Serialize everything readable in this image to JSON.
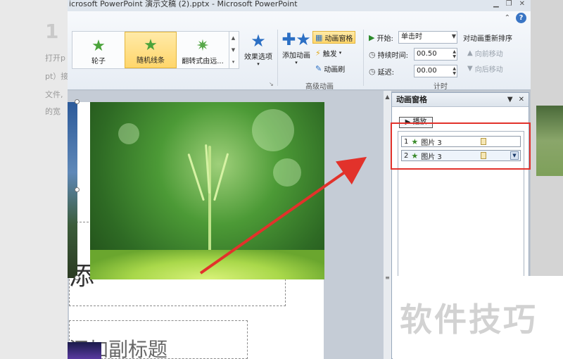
{
  "window": {
    "title": "icrosoft PowerPoint 演示文稿 (2).pptx - Microsoft PowerPoint"
  },
  "background": {
    "big_number": "1",
    "lines": [
      "打开p",
      "pt）接",
      "文件,",
      "的宽"
    ]
  },
  "ribbon": {
    "gallery_items": [
      {
        "label": "轮子",
        "icon": "star-icon"
      },
      {
        "label": "随机线条",
        "icon": "star-icon",
        "selected": true
      },
      {
        "label": "翻转式由远...",
        "icon": "star-burst-icon"
      }
    ],
    "effect_options": {
      "label": "效果选项",
      "icon": "star-icon"
    },
    "add_animation": {
      "label": "添加动画",
      "icon": "star-plus-icon"
    },
    "animation_pane": {
      "label": "动画窗格",
      "icon": "pane-icon"
    },
    "trigger": {
      "label": "触发",
      "icon": "lightning-icon"
    },
    "animation_painter": {
      "label": "动画刷",
      "icon": "brush-icon"
    },
    "advanced_group_label": "高级动画",
    "timing": {
      "start_label": "开始:",
      "start_value": "单击时",
      "duration_label": "持续时间:",
      "duration_value": "00.50",
      "delay_label": "延迟:",
      "delay_value": "00.00",
      "group_label": "计时"
    },
    "reorder": {
      "title": "对动画重新排序",
      "move_earlier": "向前移动",
      "move_later": "向后移动"
    }
  },
  "slide": {
    "title_char": "添",
    "subtitle": "添加副标题"
  },
  "animation_pane": {
    "title": "动画窗格",
    "play_label": "播放",
    "items": [
      {
        "index": "1",
        "name": "图片 3"
      },
      {
        "index": "2",
        "name": "图片 3"
      }
    ]
  },
  "watermark": "软件技巧",
  "colors": {
    "highlight": "#ffd66b",
    "annotation_red": "#e2322b",
    "accent_blue": "#2b6fc4"
  }
}
